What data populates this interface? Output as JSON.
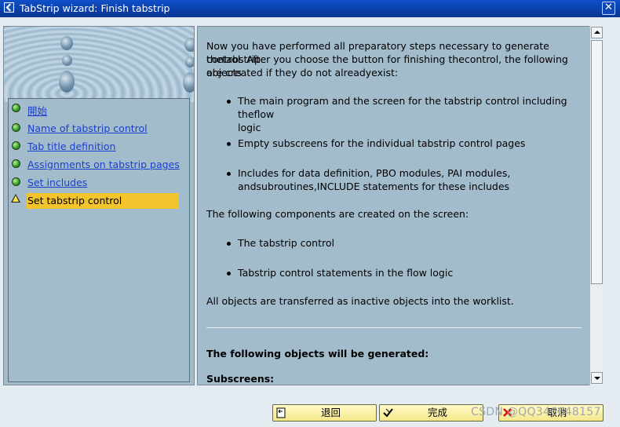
{
  "window": {
    "title": "TabStrip wizard: Finish tabstrip",
    "close_symbol": "✕"
  },
  "steps": [
    {
      "label": "開始",
      "status": "done"
    },
    {
      "label": "Name of tabstrip control",
      "status": "done"
    },
    {
      "label": "Tab title definition",
      "status": "done"
    },
    {
      "label": "Assignments on tabstrip pages",
      "status": "done"
    },
    {
      "label": "Set includes",
      "status": "done"
    },
    {
      "label": "Set tabstrip control",
      "status": "current"
    }
  ],
  "content": {
    "intro_1": "Now you have performed all preparatory steps necessary to generate thetabstrip",
    "intro_2": "control. After you choose the button for finishing thecontrol, the following objects",
    "intro_3": "are created if they do not alreadyexist:",
    "bullets_1": [
      {
        "line1": "The main program and the screen for the tabstrip control including theflow",
        "line2": "logic"
      },
      {
        "line1": "Empty subscreens for the individual tabstrip control pages",
        "line2": ""
      },
      {
        "line1": "Includes for data definition, PBO modules, PAI modules,",
        "line2": "andsubroutines,INCLUDE statements for these includes"
      }
    ],
    "screen_intro": "The following components are created on the screen:",
    "bullets_2": [
      "The tabstrip control",
      "Tabstrip control statements in the flow logic"
    ],
    "transfer_note": "All objects are transferred as inactive objects into the worklist.",
    "generated_heading": "The following objects will be generated:",
    "subscreens_heading": "Subscreens:"
  },
  "buttons": {
    "back": {
      "label": "退回",
      "icon": "back-icon"
    },
    "finish": {
      "label": "完成",
      "icon": "check-icon"
    },
    "cancel": {
      "label": "取消",
      "icon": "cancel-icon"
    }
  },
  "watermark": "CSDN @QQ346648157",
  "colors": {
    "titlebar": "#0a3fa8",
    "pane": "#a3bccc",
    "active_step": "#f4c42c",
    "link": "#1a3fcc"
  }
}
